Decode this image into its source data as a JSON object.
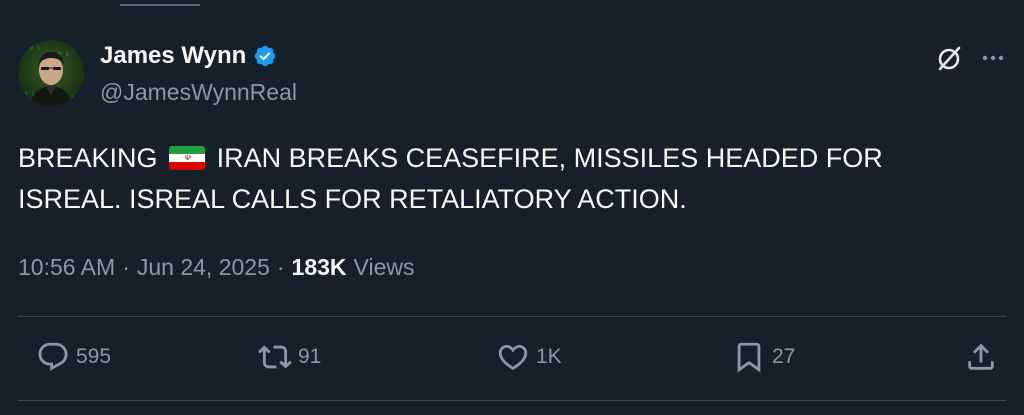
{
  "author": {
    "display_name": "James Wynn",
    "handle": "@JamesWynnReal",
    "verified": true,
    "verified_color": "#1d9bf0"
  },
  "tweet": {
    "text_before_flag": "BREAKING",
    "flag_icon": "iran-flag-emoji",
    "text_after_flag": "IRAN BREAKS CEASEFIRE, MISSILES HEADED FOR ISREAL. ISREAL CALLS FOR RETALIATORY ACTION."
  },
  "meta": {
    "time": "10:56 AM",
    "separator": "·",
    "date": "Jun 24, 2025",
    "views_count": "183K",
    "views_label": "Views"
  },
  "actions": {
    "replies": "595",
    "reposts": "91",
    "likes": "1K",
    "bookmarks": "27"
  },
  "theme": {
    "background": "#15202b",
    "text": "#f7f9f9",
    "muted": "#8b98a5",
    "divider": "#38444d"
  }
}
